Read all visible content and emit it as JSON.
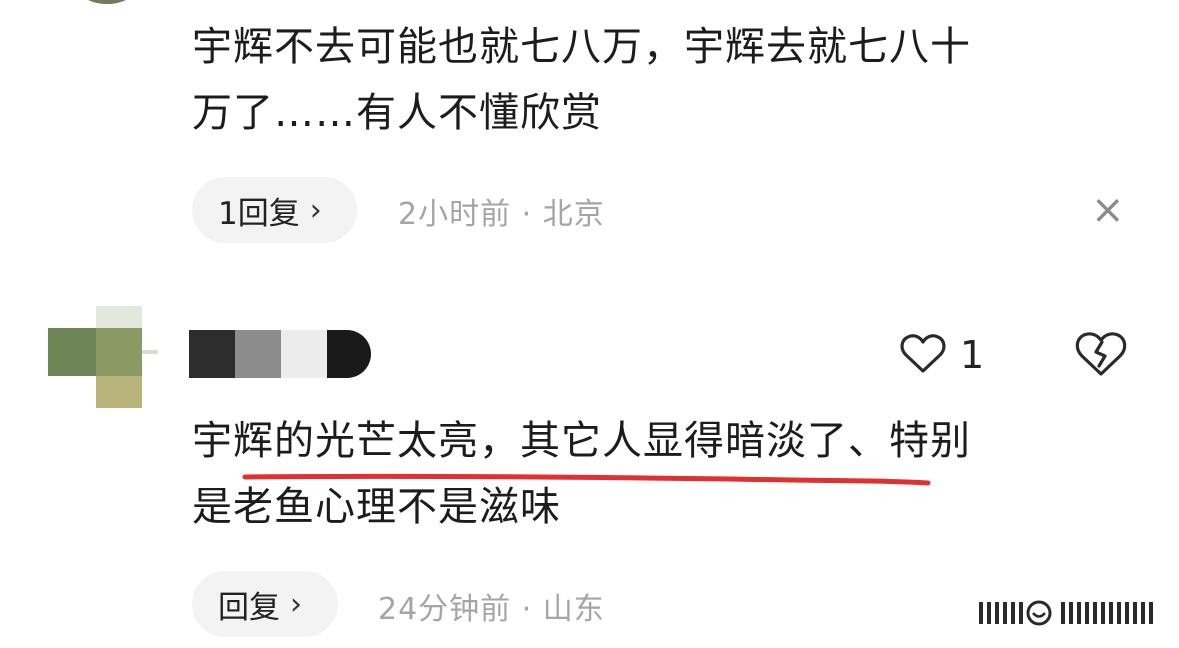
{
  "comments": [
    {
      "text_line1": "宇辉不去可能也就七八万，宇辉去就七八十",
      "text_line2": "万了……有人不懂欣赏",
      "reply_label": "1回复",
      "meta": "2小时前 · 北京"
    },
    {
      "text_line1": "宇辉的光芒太亮，其它人显得暗淡了、特别",
      "text_line2": "是老鱼心理不是滋味",
      "like_count": "1",
      "reply_label": "回复",
      "meta": "24分钟前 · 山东"
    }
  ],
  "icons": {
    "chevron": "›",
    "close": "×",
    "like": "heart-outline-icon",
    "dislike": "broken-heart-icon"
  },
  "colors": {
    "text": "#1c1c1c",
    "meta": "#a5a5a5",
    "pill_bg": "#f3f3f3",
    "annotation_underline": "#e0302f"
  }
}
